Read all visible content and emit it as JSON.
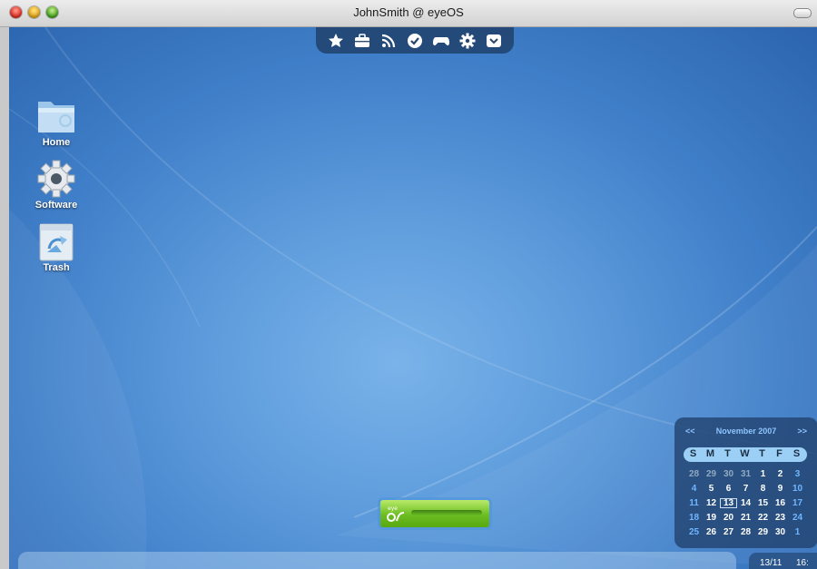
{
  "window": {
    "title": "JohnSmith @ eyeOS"
  },
  "dock": {
    "items": [
      {
        "name": "favorites",
        "icon": "star-icon"
      },
      {
        "name": "office",
        "icon": "briefcase-icon"
      },
      {
        "name": "feeds",
        "icon": "rss-icon"
      },
      {
        "name": "tasks",
        "icon": "check-circle-icon"
      },
      {
        "name": "games",
        "icon": "gamepad-icon"
      },
      {
        "name": "settings",
        "icon": "gear-icon"
      },
      {
        "name": "downloads",
        "icon": "inbox-icon"
      }
    ]
  },
  "desktop_icons": [
    {
      "label": "Home",
      "icon": "folder-icon"
    },
    {
      "label": "Software",
      "icon": "gear-icon"
    },
    {
      "label": "Trash",
      "icon": "trash-icon"
    }
  ],
  "calendar": {
    "prev": "<<",
    "month_label": "November 2007",
    "next": ">>",
    "weekdays": [
      "S",
      "M",
      "T",
      "W",
      "T",
      "F",
      "S"
    ],
    "weeks": [
      [
        {
          "d": "28",
          "t": "other"
        },
        {
          "d": "29",
          "t": "other"
        },
        {
          "d": "30",
          "t": "other"
        },
        {
          "d": "31",
          "t": "other"
        },
        {
          "d": "1",
          "t": "cur"
        },
        {
          "d": "2",
          "t": "cur"
        },
        {
          "d": "3",
          "t": "wknd"
        }
      ],
      [
        {
          "d": "4",
          "t": "wknd"
        },
        {
          "d": "5",
          "t": "cur"
        },
        {
          "d": "6",
          "t": "cur"
        },
        {
          "d": "7",
          "t": "cur"
        },
        {
          "d": "8",
          "t": "cur"
        },
        {
          "d": "9",
          "t": "cur"
        },
        {
          "d": "10",
          "t": "wknd"
        }
      ],
      [
        {
          "d": "11",
          "t": "wknd"
        },
        {
          "d": "12",
          "t": "cur"
        },
        {
          "d": "13",
          "t": "today"
        },
        {
          "d": "14",
          "t": "cur"
        },
        {
          "d": "15",
          "t": "cur"
        },
        {
          "d": "16",
          "t": "cur"
        },
        {
          "d": "17",
          "t": "wknd"
        }
      ],
      [
        {
          "d": "18",
          "t": "wknd"
        },
        {
          "d": "19",
          "t": "cur"
        },
        {
          "d": "20",
          "t": "cur"
        },
        {
          "d": "21",
          "t": "cur"
        },
        {
          "d": "22",
          "t": "cur"
        },
        {
          "d": "23",
          "t": "cur"
        },
        {
          "d": "24",
          "t": "wknd"
        }
      ],
      [
        {
          "d": "25",
          "t": "wknd"
        },
        {
          "d": "26",
          "t": "cur"
        },
        {
          "d": "27",
          "t": "cur"
        },
        {
          "d": "28",
          "t": "cur"
        },
        {
          "d": "29",
          "t": "cur"
        },
        {
          "d": "30",
          "t": "cur"
        },
        {
          "d": "1",
          "t": "wknd"
        }
      ]
    ]
  },
  "badge": {
    "icon": "eyeos-logo-icon"
  },
  "clock": {
    "date": "13/11",
    "time": "16:"
  }
}
